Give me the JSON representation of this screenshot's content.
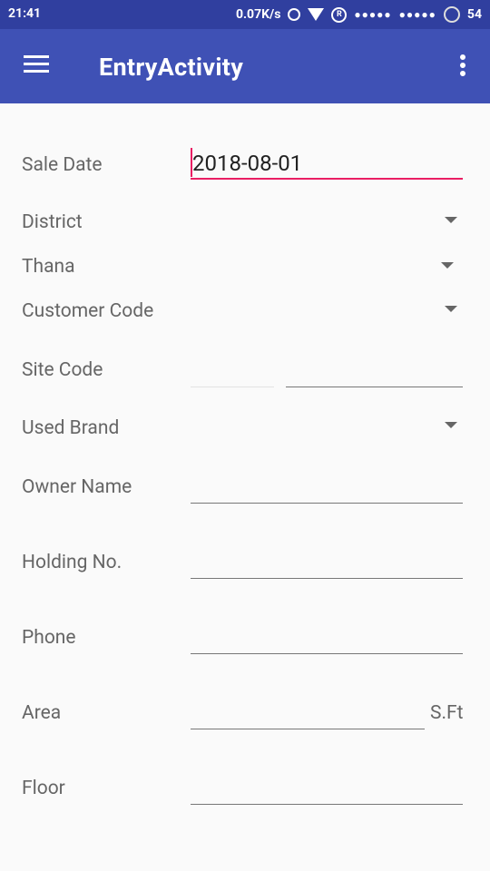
{
  "status": {
    "time": "21:41",
    "speed": "0.07K/s",
    "sim1": "●●●●●",
    "sim2": "●●●●●",
    "reg": "R",
    "battery": "54"
  },
  "appbar": {
    "title": "EntryActivity"
  },
  "form": {
    "sale_date": {
      "label": "Sale Date",
      "value": "2018-08-01"
    },
    "district": {
      "label": "District"
    },
    "thana": {
      "label": "Thana"
    },
    "customer_code": {
      "label": "Customer Code"
    },
    "site_code": {
      "label": "Site Code"
    },
    "used_brand": {
      "label": "Used Brand"
    },
    "owner_name": {
      "label": "Owner Name"
    },
    "holding_no": {
      "label": "Holding No."
    },
    "phone": {
      "label": "Phone"
    },
    "area": {
      "label": "Area",
      "suffix": "S.Ft"
    },
    "floor": {
      "label": "Floor"
    }
  }
}
